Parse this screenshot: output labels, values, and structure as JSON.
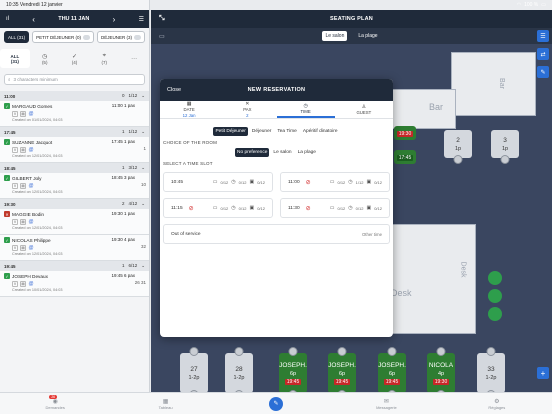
{
  "status": {
    "time": "10:35",
    "date": "Vendredi 12 janvier",
    "battery": "100 %"
  },
  "left": {
    "date": "THU 11 JAN",
    "chips": [
      {
        "label": "ALL (31)",
        "active": true
      },
      {
        "label": "PETIT DÉJEUNER (0)",
        "active": false
      },
      {
        "label": "DÉJEUNER (3)",
        "active": false
      }
    ],
    "filters": [
      {
        "icon": "⊞",
        "label": "ALL",
        "count": "(31)"
      },
      {
        "icon": "◷",
        "label": "",
        "count": "(5)"
      },
      {
        "icon": "✓",
        "label": "",
        "count": "(4)"
      },
      {
        "icon": "⌖",
        "label": "",
        "count": "(7)"
      },
      {
        "icon": "···",
        "label": "",
        "count": ""
      }
    ],
    "search_placeholder": "3 characters minimum",
    "groups": [
      {
        "time": "11:00",
        "seated": "0",
        "covers": "1/12"
      },
      {
        "time": "17:45",
        "seated": "1",
        "covers": "1/12"
      },
      {
        "time": "18:45",
        "seated": "1",
        "covers": "3/12"
      },
      {
        "time": "19:30",
        "seated": "2",
        "covers": "4/12"
      },
      {
        "time": "19:45",
        "seated": "1",
        "covers": "6/12"
      }
    ],
    "reservations": [
      {
        "name": "MARGAUD Gomes",
        "time": "11:00",
        "pax": "1 pax",
        "table": "",
        "created": "Created on 01/01/2024, 04:03"
      },
      {
        "name": "SUZANNE Jacquot",
        "time": "17:45",
        "pax": "1 pax",
        "table": "1",
        "created": "Created on 12/01/2024, 04:03"
      },
      {
        "name": "GILBERT Joly",
        "time": "18:45",
        "pax": "3 pax",
        "table": "10",
        "created": "Created on 12/01/2024, 04:03"
      },
      {
        "name": "MAGGIE Bodin",
        "time": "19:30",
        "pax": "1 pax",
        "table": "",
        "created": "Created on 12/01/2024, 04:03"
      },
      {
        "name": "NICOLAS Philippe",
        "time": "19:30",
        "pax": "4 pax",
        "table": "32",
        "created": "Created on 12/01/2024, 04:03"
      },
      {
        "name": "JOSEPH Devaux",
        "time": "19:45",
        "pax": "6 pax",
        "table": "26 31",
        "created": "Created on 10/01/2024, 04:03"
      }
    ]
  },
  "main": {
    "title": "SEATING PLAN",
    "rooms": [
      "Le salon",
      "La plage"
    ],
    "active_room": "Le salon",
    "labels": {
      "bar": "Bar",
      "desk": "Desk"
    },
    "bottom_tables": [
      {
        "num": "27",
        "cap": "1-2p",
        "time": "",
        "green": false
      },
      {
        "num": "28",
        "cap": "1-2p",
        "time": "",
        "green": false
      },
      {
        "num": "JOSEPH.",
        "cap": "6p",
        "time": "19:45",
        "green": true
      },
      {
        "num": "JOSEPH.",
        "cap": "6p",
        "time": "19:45",
        "green": true
      },
      {
        "num": "JOSEPH.",
        "cap": "6p",
        "time": "19:45",
        "green": true
      },
      {
        "num": "NICOLA",
        "cap": "4p",
        "time": "19:30",
        "green": true
      },
      {
        "num": "33",
        "cap": "1-2p",
        "time": "",
        "green": false
      }
    ],
    "bar_tables": [
      {
        "num": "2",
        "cap": "1p"
      },
      {
        "num": "3",
        "cap": "1p"
      }
    ],
    "bar_seat_times": [
      "19:30",
      "17:45"
    ]
  },
  "modal": {
    "close": "Close",
    "title": "NEW RESERVATION",
    "steps": [
      {
        "icon": "▦",
        "label": "DATE",
        "value": "12 Jan"
      },
      {
        "icon": "✕",
        "label": "PAX",
        "value": "2"
      },
      {
        "icon": "◷",
        "label": "TIME",
        "value": ""
      },
      {
        "icon": "♙",
        "label": "GUEST",
        "value": ""
      }
    ],
    "services": [
      "Petit Déjeuner",
      "Déjeuner",
      "Tea Time",
      "Apéritif dinatoire"
    ],
    "active_service": "Petit Déjeuner",
    "room_label": "CHOICE OF THE ROOM",
    "room_options": [
      "No preference",
      "Le salon",
      "La plage"
    ],
    "active_room": "No preference",
    "slot_label": "SELECT A TIME SLOT",
    "slots": [
      {
        "time": "10:45",
        "available": true,
        "a": "0/12",
        "b": "0/12",
        "c": "0/12"
      },
      {
        "time": "11:00",
        "available": false,
        "a": "0/12",
        "b": "1/12",
        "c": "0/12"
      },
      {
        "time": "11:15",
        "available": false,
        "a": "0/12",
        "b": "0/12",
        "c": "0/12"
      },
      {
        "time": "11:30",
        "available": false,
        "a": "0/12",
        "b": "0/12",
        "c": "0/12"
      }
    ],
    "out_of_service": "Out of service",
    "other_time": "Other time"
  },
  "bottomnav": [
    {
      "icon": "◉",
      "label": "Demandes",
      "badge": "26"
    },
    {
      "icon": "▦",
      "label": "Tableau",
      "badge": ""
    },
    {
      "icon": "✎",
      "label": "",
      "badge": ""
    },
    {
      "icon": "✉",
      "label": "Messagerie",
      "badge": ""
    },
    {
      "icon": "⚙",
      "label": "Réglages",
      "badge": ""
    }
  ],
  "colors": {
    "navy": "#1f2a3a",
    "accent": "#2b6fd6",
    "green": "#2e7d32",
    "red": "#c62828",
    "floor": "#3a4660"
  }
}
